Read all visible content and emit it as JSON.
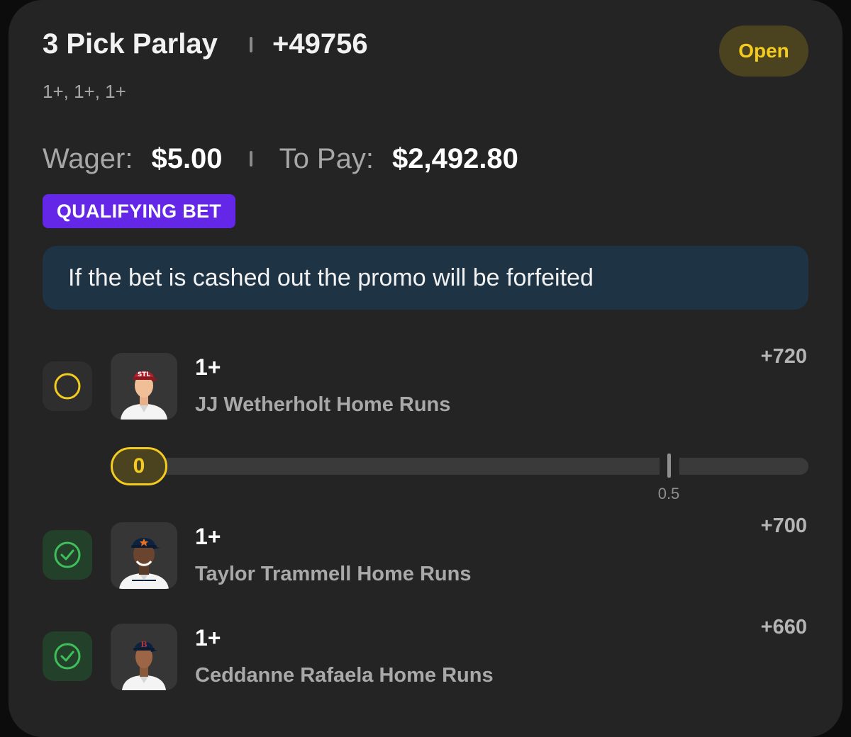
{
  "header": {
    "title": "3 Pick Parlay",
    "total_odds": "+49756",
    "status": "Open",
    "lines_summary": "1+, 1+, 1+"
  },
  "wager": {
    "wager_label": "Wager:",
    "wager_value": "$5.00",
    "pay_label": "To Pay:",
    "pay_value": "$2,492.80"
  },
  "qualifying_badge": "QUALIFYING BET",
  "promo_notice": "If the bet is cashed out the promo will be forfeited",
  "picks": [
    {
      "line": "1+",
      "market": "JJ Wetherholt Home Runs",
      "odds": "+720",
      "status": "pending",
      "progress": {
        "current": "0",
        "threshold": "0.5"
      },
      "cap_color": "#b3202a",
      "jersey_color": "#f4f4f4"
    },
    {
      "line": "1+",
      "market": "Taylor Trammell Home Runs",
      "odds": "+700",
      "status": "won",
      "cap_color": "#0c2340",
      "jersey_color": "#f4f4f4"
    },
    {
      "line": "1+",
      "market": "Ceddanne Rafaela Home Runs",
      "odds": "+660",
      "status": "won",
      "cap_color": "#0c2340",
      "jersey_color": "#f4f4f4"
    }
  ],
  "icons": {
    "pending": "circle-outline-icon",
    "won": "check-circle-icon"
  },
  "colors": {
    "accent_yellow": "#f4cc1f",
    "win_green": "#3fbf5a",
    "qualifying_purple": "#6427e8",
    "promo_bg": "#1e3344"
  }
}
